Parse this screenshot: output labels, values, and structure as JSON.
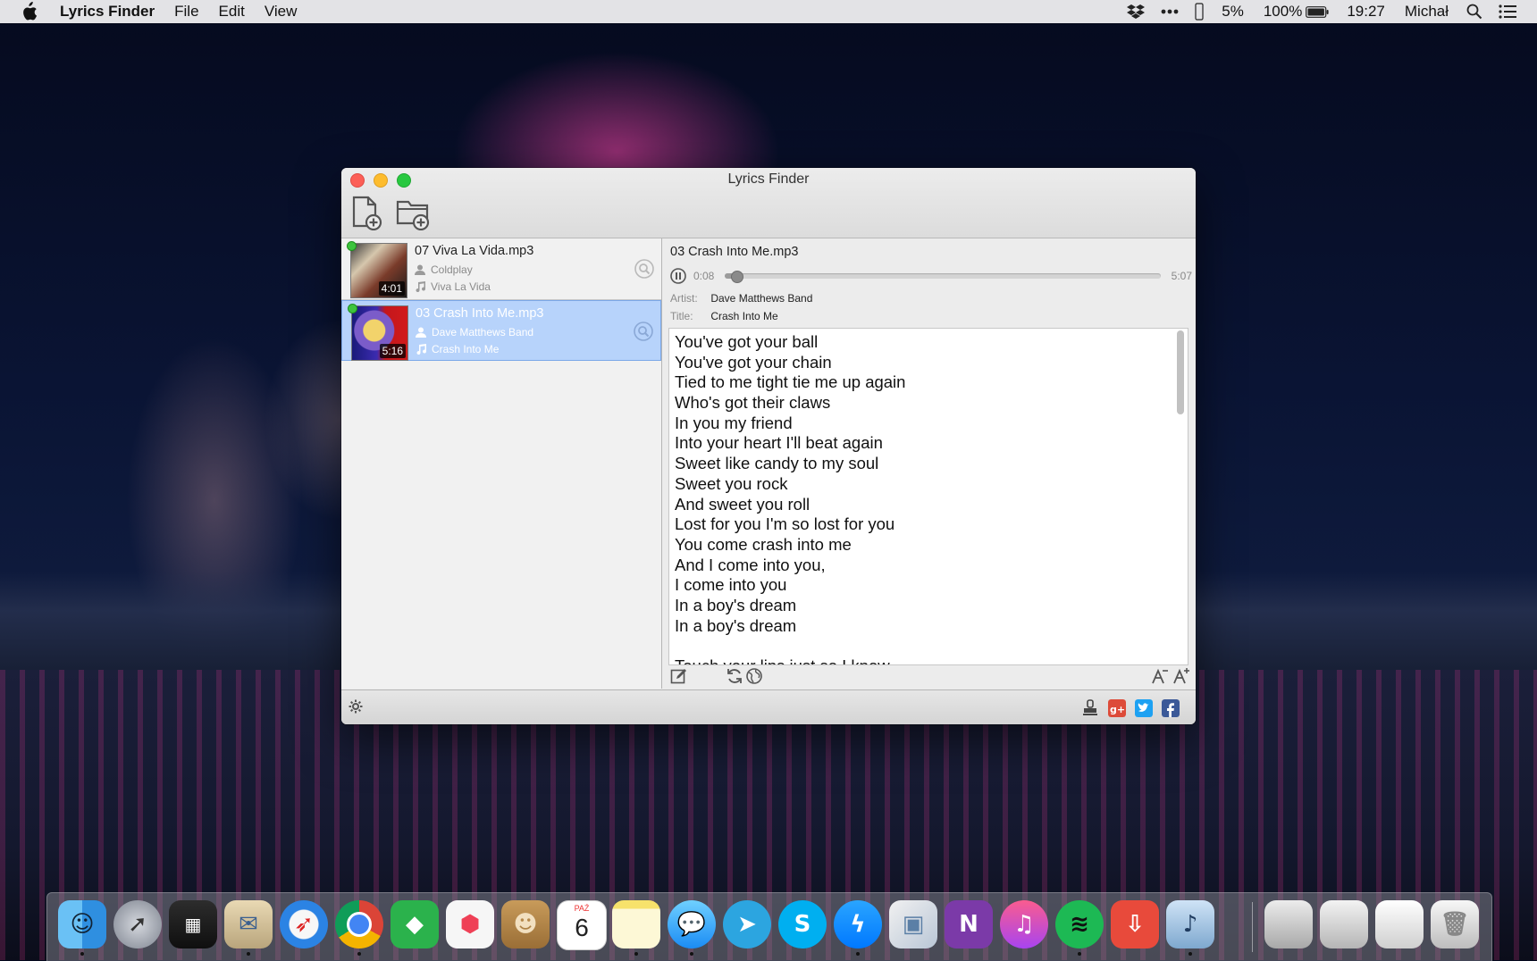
{
  "menubar": {
    "app_name": "Lyrics Finder",
    "menus": [
      "File",
      "Edit",
      "View"
    ],
    "battery_small": "5%",
    "battery": "100%",
    "clock": "19:27",
    "user": "Michał",
    "icons": [
      "dropbox-icon",
      "more-icon",
      "battery-icon",
      "spotlight-icon",
      "notification-center-icon"
    ]
  },
  "window": {
    "title": "Lyrics Finder",
    "toolbar": {
      "add_file_icon": "add-file-icon",
      "add_folder_icon": "add-folder-icon"
    }
  },
  "songs": [
    {
      "file": "07 Viva La Vida.mp3",
      "artist": "Coldplay",
      "title": "Viva La Vida",
      "duration": "4:01",
      "selected": false
    },
    {
      "file": "03 Crash Into Me.mp3",
      "artist": "Dave Matthews Band",
      "title": "Crash Into Me",
      "duration": "5:16",
      "selected": true
    }
  ],
  "detail": {
    "file": "03 Crash Into Me.mp3",
    "current_time": "0:08",
    "total_time": "5:07",
    "progress": 0.026,
    "artist_label": "Artist:",
    "artist": "Dave Matthews Band",
    "title_label": "Title:",
    "title": "Crash Into Me",
    "lyrics": [
      "You've got your ball",
      "You've got your chain",
      "Tied to me tight tie me up again",
      "Who's got their claws",
      "In you my friend",
      "Into your heart I'll beat again",
      "Sweet like candy to my soul",
      "Sweet you rock",
      "And sweet you roll",
      "Lost for you I'm so lost for you",
      "You come crash into me",
      "And I come into you,",
      "I come into you",
      "In a boy's dream",
      "In a boy's dream",
      "",
      "Touch your lips just so I know"
    ]
  },
  "colors": {
    "accent": "#b7d3fb",
    "selection_border": "#7aa7e8"
  },
  "dock_apps": [
    "Finder",
    "Launchpad",
    "Mission Control",
    "Mail",
    "Safari",
    "Chrome",
    "Feedly",
    "Pocket",
    "Contacts",
    "Calendar",
    "Notes",
    "Messages",
    "Telegram",
    "Skype",
    "Messenger",
    "Preview",
    "OneNote",
    "iTunes",
    "Spotify",
    "Transmit",
    "Lyrics Finder",
    "Applications",
    "Downloads",
    "Documents",
    "Trash"
  ],
  "calendar": {
    "month": "PAŹ",
    "day": "6"
  }
}
